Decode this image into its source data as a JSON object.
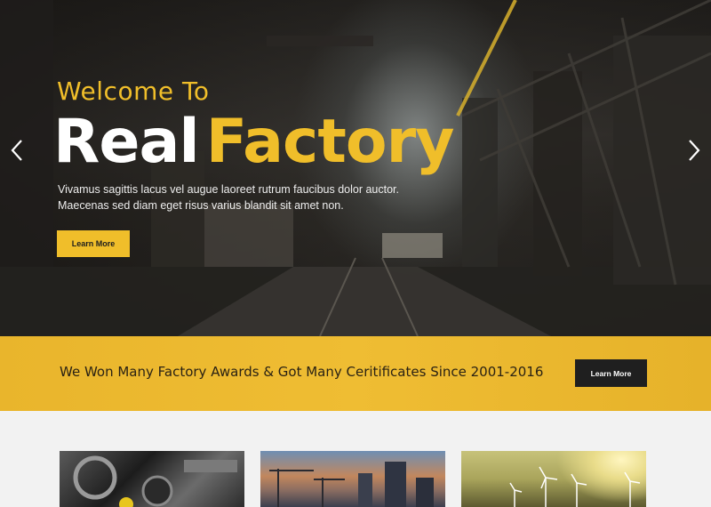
{
  "hero": {
    "welcome": "Welcome To",
    "title_part1": "Real",
    "title_part2": "Factory",
    "description_line1": "Vivamus sagittis lacus vel augue laoreet rutrum faucibus dolor auctor.",
    "description_line2": "Maecenas sed diam eget risus varius blandit sit amet non.",
    "button_label": "Learn More",
    "prev_icon": "chevron-left-icon",
    "next_icon": "chevron-right-icon"
  },
  "awards": {
    "text": "We Won Many Factory Awards & Got Many Ceritificates Since 2001-2016",
    "button_label": "Learn More"
  },
  "cards": [
    {
      "image": "engine-parts"
    },
    {
      "image": "city-skyline-cranes"
    },
    {
      "image": "wind-turbines-sunset"
    }
  ],
  "colors": {
    "accent": "#f0be2a",
    "dark_button": "#1f1f1f",
    "page_background": "#f2f2f2"
  }
}
